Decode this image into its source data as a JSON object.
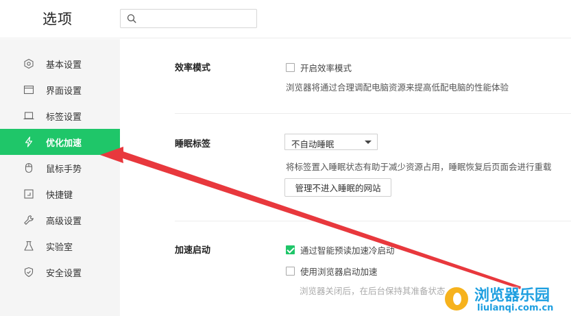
{
  "header": {
    "title": "选项",
    "search": {
      "value": "",
      "placeholder": ""
    }
  },
  "sidebar": {
    "items": [
      {
        "label": "基本设置",
        "icon": "hexagon-settings-icon"
      },
      {
        "label": "界面设置",
        "icon": "window-icon"
      },
      {
        "label": "标签设置",
        "icon": "tab-icon"
      },
      {
        "label": "优化加速",
        "icon": "lightning-icon",
        "active": true
      },
      {
        "label": "鼠标手势",
        "icon": "mouse-icon"
      },
      {
        "label": "快捷键",
        "icon": "keyboard-shortcut-icon"
      },
      {
        "label": "高级设置",
        "icon": "wrench-icon"
      },
      {
        "label": "实验室",
        "icon": "flask-icon"
      },
      {
        "label": "安全设置",
        "icon": "shield-icon"
      }
    ]
  },
  "sections": {
    "efficiency": {
      "title": "效率模式",
      "checkbox_label": "开启效率模式",
      "checked": false,
      "description": "浏览器将通过合理调配电脑资源来提高低配电脑的性能体验"
    },
    "sleep": {
      "title": "睡眠标签",
      "dropdown_value": "不自动睡眠",
      "description": "将标签置入睡眠状态有助于减少资源占用，睡眠恢复后页面会进行重载",
      "button_label": "管理不进入睡眠的网站"
    },
    "boost": {
      "title": "加速启动",
      "option1_label": "通过智能预读加速冷启动",
      "option1_checked": true,
      "option2_label": "使用浏览器启动加速",
      "option2_checked": false,
      "description": "浏览器关闭后，在后台保持其准备状态"
    }
  },
  "watermark": {
    "title": "浏览器乐园",
    "url": "liulanqi.com.cn"
  },
  "colors": {
    "accent": "#1fc669",
    "annotation_arrow": "#e8383d",
    "watermark_blue": "#1e9fe0",
    "watermark_orange": "#f6b21d"
  }
}
